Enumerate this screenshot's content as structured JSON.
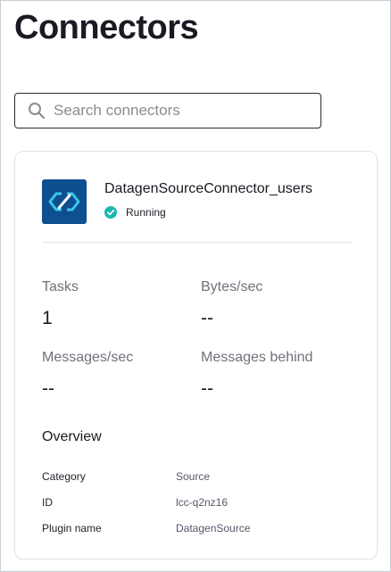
{
  "header": {
    "title": "Connectors"
  },
  "search": {
    "placeholder": "Search connectors",
    "value": ""
  },
  "connector": {
    "name": "DatagenSourceConnector_users",
    "status": "Running",
    "status_color": "#1bb7b0",
    "logo_color": "#0d4f8f",
    "logo_icon": "connector-link-icon"
  },
  "metrics": [
    {
      "label": "Tasks",
      "value": "1"
    },
    {
      "label": "Bytes/sec",
      "value": "--"
    },
    {
      "label": "Messages/sec",
      "value": "--"
    },
    {
      "label": "Messages behind",
      "value": "--"
    }
  ],
  "overview": {
    "title": "Overview",
    "rows": [
      {
        "key": "Category",
        "value": "Source"
      },
      {
        "key": "ID",
        "value": "lcc-q2nz16"
      },
      {
        "key": "Plugin name",
        "value": "DatagenSource"
      }
    ]
  }
}
